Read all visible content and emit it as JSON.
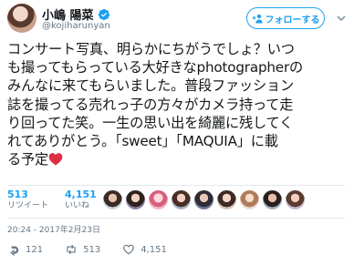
{
  "user": {
    "display_name": "小嶋 陽菜",
    "handle": "@kojiharunyan"
  },
  "follow_button": {
    "label": "フォローする"
  },
  "tweet": {
    "lines": [
      "コンサート写真、明らかにちがうでしょ？いつ",
      "も撮ってもらっている大好きなphotographerの",
      "みんなに来てもらいました。普段ファッション",
      "誌を撮ってる売れっ子の方々がカメラ持って走",
      "り回ってた笑。一生の思い出を綺麗に残してく",
      "れてありがとう。「sweet」「MAQUIA」に載",
      "る予定"
    ]
  },
  "stats": {
    "retweets": {
      "count": "513",
      "label": "リツイート"
    },
    "likes": {
      "count": "4,151",
      "label": "いいね"
    }
  },
  "timestamp": "20:24 - 2017年2月23日",
  "actions": {
    "reply_count": "121",
    "retweet_count": "513",
    "like_count": "4,151"
  },
  "colors": {
    "accent": "#1da1f2",
    "heart": "#e0245e",
    "muted": "#657786"
  },
  "icons": [
    "verified-badge-icon",
    "caret-down-icon",
    "reply-icon",
    "retweet-icon",
    "like-icon",
    "heart-emoji-icon"
  ]
}
